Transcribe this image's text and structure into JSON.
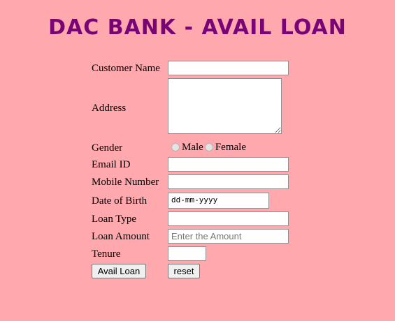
{
  "title": "DAC BANK - AVAIL LOAN",
  "form": {
    "customer_name": {
      "label": "Customer Name",
      "value": ""
    },
    "address": {
      "label": "Address",
      "value": ""
    },
    "gender": {
      "label": "Gender",
      "options": [
        "Male",
        "Female"
      ],
      "selected": null
    },
    "email": {
      "label": "Email ID",
      "value": ""
    },
    "mobile": {
      "label": "Mobile Number",
      "value": ""
    },
    "dob": {
      "label": "Date of Birth",
      "placeholder": "dd-mm-yyyy"
    },
    "loan_type": {
      "label": "Loan Type",
      "value": ""
    },
    "loan_amount": {
      "label": "Loan Amount",
      "placeholder": "Enter the Amount"
    },
    "tenure": {
      "label": "Tenure",
      "value": ""
    }
  },
  "buttons": {
    "submit": "Avail Loan",
    "reset": "reset"
  },
  "icons": {
    "radio": "radio-button-icon"
  },
  "colors": {
    "background": "#ffa8ad",
    "title": "#780478"
  }
}
